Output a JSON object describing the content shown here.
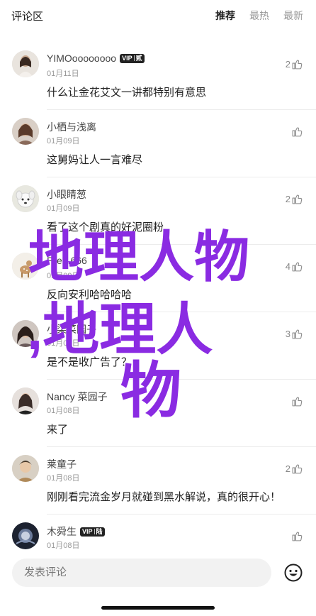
{
  "header": {
    "title": "评论区",
    "tabs": [
      {
        "label": "推荐",
        "active": true
      },
      {
        "label": "最热",
        "active": false
      },
      {
        "label": "最新",
        "active": false
      }
    ]
  },
  "comments": [
    {
      "user": "YIMOoooooooo",
      "vip": true,
      "vip_label": "VIP",
      "vip_extra": "贰",
      "date": "01月11日",
      "text": "什么让金花艾文一讲都特别有意思",
      "likes": "2",
      "avatar": "avatar-girl-icon"
    },
    {
      "user": "小栖与浅离",
      "vip": false,
      "date": "01月09日",
      "text": "这舅妈让人一言难尽",
      "likes": "",
      "avatar": "avatar-woman-icon"
    },
    {
      "user": "小眼睛葱",
      "vip": false,
      "date": "01月09日",
      "text": "看了这个剧真的好泥圈粉",
      "likes": "2",
      "avatar": "avatar-dog-icon"
    },
    {
      "user": "Pre...666",
      "vip": false,
      "date": "01月09日",
      "text": "反向安利哈哈哈哈",
      "likes": "4",
      "avatar": "avatar-deer-icon"
    },
    {
      "user": "小柒菜园子",
      "vip": false,
      "date": "01月08日",
      "text": "是不是收广告了？",
      "likes": "3",
      "avatar": "avatar-lady-icon"
    },
    {
      "user": "Nancy 菜园子",
      "vip": false,
      "date": "01月08日",
      "text": "来了",
      "likes": "",
      "avatar": "avatar-nancy-icon"
    },
    {
      "user": "莱童子",
      "vip": false,
      "date": "01月08日",
      "text": "刚刚看完流金岁月就碰到黑水解说，真的很开心！",
      "likes": "2",
      "avatar": "avatar-child-icon"
    },
    {
      "user": "木舜生",
      "vip": true,
      "vip_label": "VIP",
      "vip_extra": "陆",
      "date": "01月08日",
      "text": "",
      "likes": "",
      "avatar": "avatar-ink-icon"
    }
  ],
  "overlay": {
    "line1": "地理人物",
    "line2": ",地理人",
    "line3": "物",
    "color": "#8a2be2"
  },
  "composer": {
    "placeholder": "发表评论"
  }
}
